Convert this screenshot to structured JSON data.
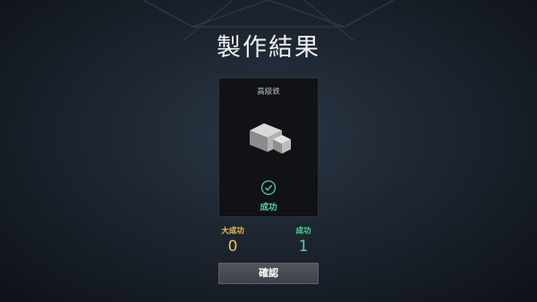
{
  "header": {
    "title": "製作結果"
  },
  "card": {
    "item_name": "高級鉄",
    "item_icon": "iron-ingot-icon",
    "result_icon": "check-icon",
    "result_label": "成功"
  },
  "stats": {
    "great_success": {
      "label": "大成功",
      "value": "0"
    },
    "success": {
      "label": "成功",
      "value": "1"
    }
  },
  "confirm_button": {
    "label": "確認"
  },
  "colors": {
    "success": "#4fd6a0",
    "great_success": "#f1c04c",
    "button": "#474c52"
  }
}
